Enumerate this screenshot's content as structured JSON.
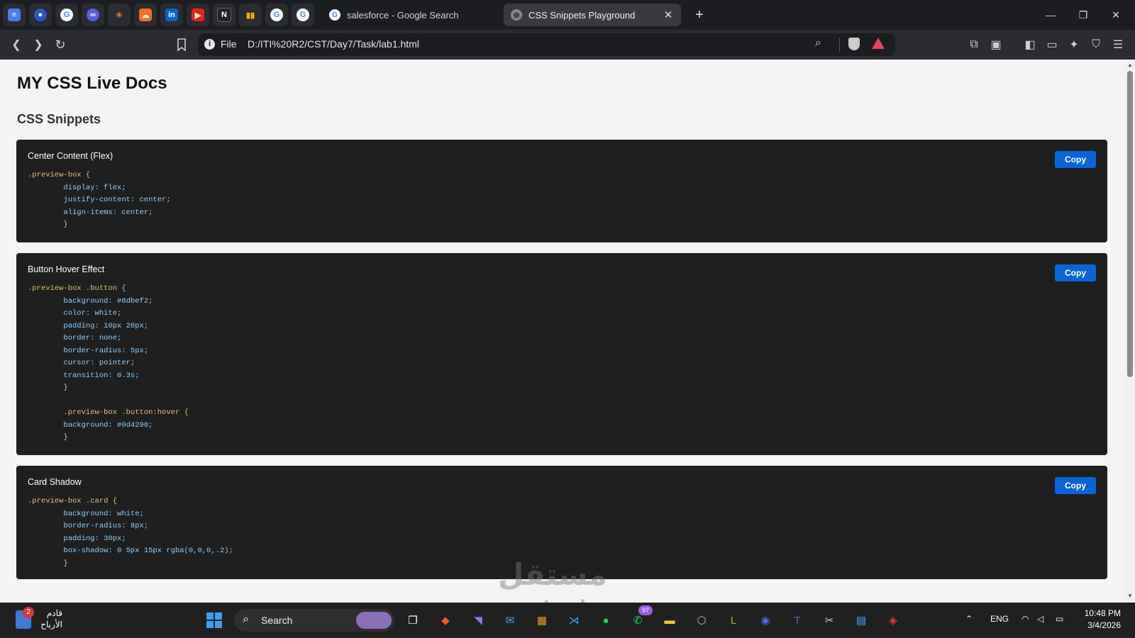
{
  "browser": {
    "pinned_icons": [
      "docs-icon",
      "circle-icon",
      "google-icon",
      "loop-icon",
      "asterisk-icon",
      "soundcloud-icon",
      "linkedin-icon",
      "youtube-icon",
      "notion-icon",
      "chart-icon",
      "google-icon",
      "google-icon"
    ],
    "tabs": [
      {
        "label": "salesforce - Google Search"
      },
      {
        "label": "CSS Snippets Playground"
      }
    ],
    "address_label": "File",
    "url": "D:/ITI%20R2/CST/Day7/Task/lab1.html"
  },
  "page": {
    "title": "MY CSS Live Docs",
    "subtitle": "CSS Snippets",
    "copy_label": "Copy",
    "snippets": [
      {
        "title": "Center Content (Flex)",
        "lines": [
          ".preview-box {",
          "        display: flex;",
          "        justify-content: center;",
          "        align-items: center;",
          "        }"
        ]
      },
      {
        "title": "Button Hover Effect",
        "lines": [
          ".preview-box .button {",
          "        background: #8dbef2;",
          "        color: white;",
          "        padding: 10px 20px;",
          "        border: none;",
          "        border-radius: 5px;",
          "        cursor: pointer;",
          "        transition: 0.3s;",
          "        }",
          "",
          "        .preview-box .button:hover {",
          "        background: #0d4298;",
          "        }"
        ]
      },
      {
        "title": "Card Shadow",
        "lines": [
          ".preview-box .card {",
          "        background: white;",
          "        border-radius: 8px;",
          "        padding: 30px;",
          "        box-shadow: 0 5px 15px rgba(0,0,0,.2);",
          "        }"
        ]
      }
    ]
  },
  "watermark": {
    "arabic": "مستقل",
    "latin": "mostaql.com"
  },
  "taskbar": {
    "widget_text": "قادم الأرباح",
    "widget_badge": "2",
    "search_label": "Search",
    "whatsapp_badge": "97",
    "language": "ENG",
    "time": "10:48 PM",
    "date": "3/4/2026"
  },
  "colors": {
    "accent": "#0a66d8",
    "card_bg": "#1f1f1f",
    "page_bg": "#f4f4f4"
  }
}
